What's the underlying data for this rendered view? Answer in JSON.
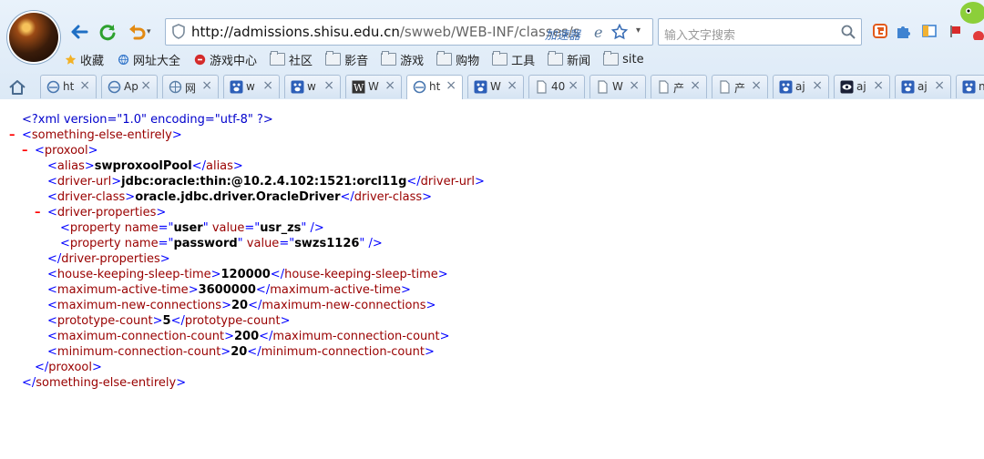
{
  "browser": {
    "url_host": "http://admissions.shisu.edu.cn",
    "url_path": "/swweb/WEB-INF/classes/s",
    "accelerator_label": "加速器",
    "search_placeholder": "输入文字搜索",
    "icons": {
      "back": "back-arrow-icon",
      "refresh": "refresh-icon",
      "undo": "undo-icon",
      "shield": "shield-icon",
      "ie": "ie-icon",
      "star": "star-icon",
      "dropdown": "chevron-down-icon",
      "search": "search-icon"
    }
  },
  "bookmarks": [
    {
      "label": "收藏",
      "icon": "star-icon"
    },
    {
      "label": "网址大全",
      "icon": "globe-icon"
    },
    {
      "label": "游戏中心",
      "icon": "game-icon"
    },
    {
      "label": "社区",
      "icon": "folder-icon"
    },
    {
      "label": "影音",
      "icon": "folder-icon"
    },
    {
      "label": "游戏",
      "icon": "folder-icon"
    },
    {
      "label": "购物",
      "icon": "folder-icon"
    },
    {
      "label": "工具",
      "icon": "folder-icon"
    },
    {
      "label": "新闻",
      "icon": "folder-icon"
    },
    {
      "label": "site",
      "icon": "folder-icon"
    }
  ],
  "tabs": [
    {
      "title": "ht",
      "icon": "ie-icon"
    },
    {
      "title": "Ap",
      "icon": "ie-icon"
    },
    {
      "title": "网",
      "icon": "globe-icon"
    },
    {
      "title": "w",
      "icon": "paw-icon"
    },
    {
      "title": "w",
      "icon": "paw-icon"
    },
    {
      "title": "W",
      "icon": "wiki-icon"
    },
    {
      "title": "ht",
      "icon": "ie-icon"
    },
    {
      "title": "W",
      "icon": "paw-icon"
    },
    {
      "title": "40",
      "icon": "page-icon"
    },
    {
      "title": "W",
      "icon": "page-icon"
    },
    {
      "title": "产",
      "icon": "page-icon"
    },
    {
      "title": "产",
      "icon": "page-icon"
    },
    {
      "title": "aj",
      "icon": "paw-icon"
    },
    {
      "title": "aj",
      "icon": "eye-icon"
    },
    {
      "title": "aj",
      "icon": "paw-icon"
    },
    {
      "title": "n",
      "icon": "paw-icon"
    }
  ],
  "xml": {
    "declaration": "<?xml version=\"1.0\" encoding=\"utf-8\" ?>",
    "root_tag": "something-else-entirely",
    "proxool_tag": "proxool",
    "alias": {
      "tag": "alias",
      "value": "swproxoolPool"
    },
    "driver_url": {
      "tag": "driver-url",
      "value": "jdbc:oracle:thin:@10.2.4.102:1521:orcl11g"
    },
    "driver_class": {
      "tag": "driver-class",
      "value": "oracle.jdbc.driver.OracleDriver"
    },
    "driver_properties_tag": "driver-properties",
    "property_user": {
      "name": "user",
      "value": "usr_zs"
    },
    "property_password": {
      "name": "password",
      "value": "swzs1126"
    },
    "house_keeping": {
      "tag": "house-keeping-sleep-time",
      "value": "120000"
    },
    "max_active": {
      "tag": "maximum-active-time",
      "value": "3600000"
    },
    "max_new": {
      "tag": "maximum-new-connections",
      "value": "20"
    },
    "prototype": {
      "tag": "prototype-count",
      "value": "5"
    },
    "max_conn": {
      "tag": "maximum-connection-count",
      "value": "200"
    },
    "min_conn": {
      "tag": "minimum-connection-count",
      "value": "20"
    }
  }
}
